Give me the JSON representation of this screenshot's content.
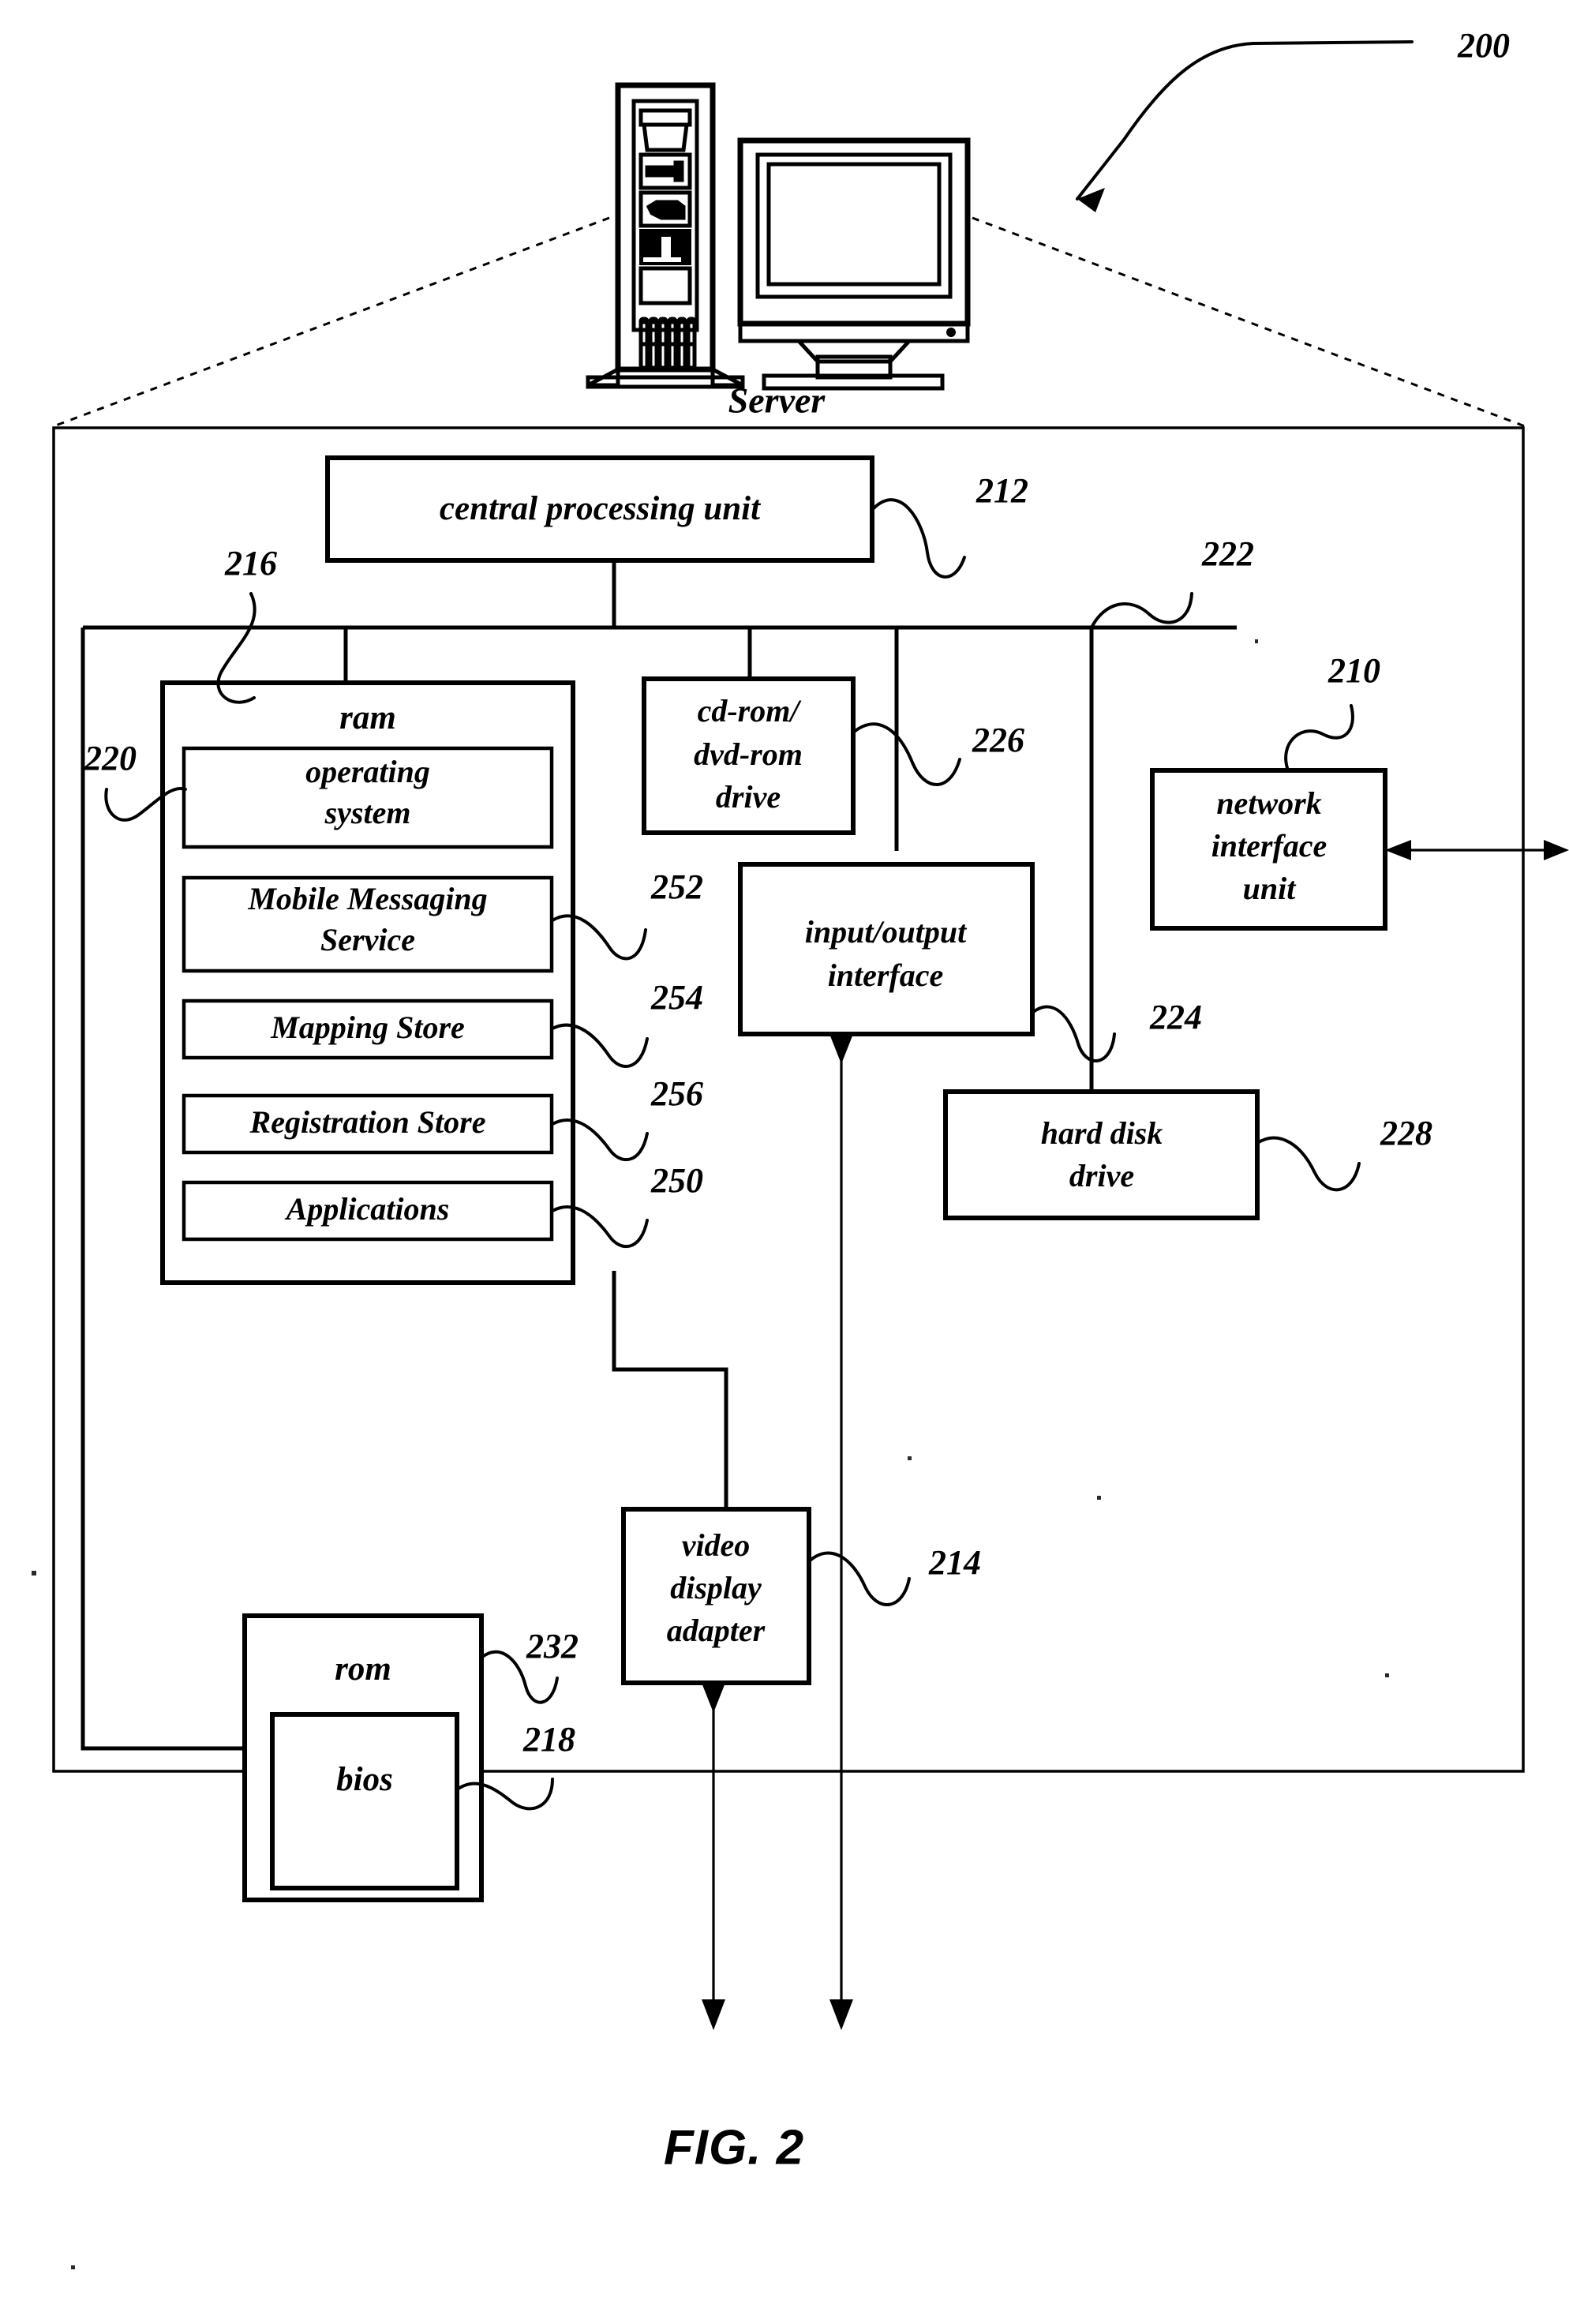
{
  "figure": {
    "caption": "FIG. 2",
    "system_ref": "200",
    "server_label": "Server"
  },
  "outer_enclosure": {
    "name": "server-internals-enclosure"
  },
  "blocks": [
    {
      "id": "cpu",
      "label": "central processing unit",
      "ref": "212"
    },
    {
      "id": "ram",
      "label": "ram",
      "ref": "216"
    },
    {
      "id": "operating-system",
      "label": "operating system",
      "ref": "220"
    },
    {
      "id": "mobile-messaging-service",
      "label": "Mobile Messaging Service",
      "ref": "252"
    },
    {
      "id": "mapping-store",
      "label": "Mapping Store",
      "ref": "254"
    },
    {
      "id": "registration-store",
      "label": "Registration Store",
      "ref": "256"
    },
    {
      "id": "applications",
      "label": "Applications",
      "ref": "250"
    },
    {
      "id": "cdrom-drive",
      "label": "cd-rom/ dvd-rom drive",
      "ref": "226"
    },
    {
      "id": "io-interface",
      "label": "input/output interface",
      "ref": "222"
    },
    {
      "id": "network-interface-unit",
      "label": "network interface unit",
      "ref": "210"
    },
    {
      "id": "hard-disk-drive",
      "label": "hard disk drive",
      "ref": "228"
    },
    {
      "id": "video-display-adapter",
      "label": "video display adapter",
      "ref": "214"
    },
    {
      "id": "rom",
      "label": "rom",
      "ref": "232"
    },
    {
      "id": "bios",
      "label": "bios",
      "ref": "218"
    }
  ],
  "labels": {
    "cpu": "central processing unit",
    "ram": "ram",
    "operating_system_line1": "operating",
    "operating_system_line2": "system",
    "mobile_messaging_line1": "Mobile Messaging",
    "mobile_messaging_line2": "Service",
    "mapping_store": "Mapping Store",
    "registration_store": "Registration Store",
    "applications": "Applications",
    "cdrom_line1": "cd-rom/",
    "cdrom_line2": "dvd-rom",
    "cdrom_line3": "drive",
    "io_line1": "input/output",
    "io_line2": "interface",
    "niu_line1": "network",
    "niu_line2": "interface",
    "niu_line3": "unit",
    "hdd_line1": "hard disk",
    "hdd_line2": "drive",
    "vda_line1": "video",
    "vda_line2": "display",
    "vda_line3": "adapter",
    "rom": "rom",
    "bios": "bios"
  },
  "reference_numerals": {
    "system": "200",
    "network_interface_unit": "210",
    "cpu": "212",
    "video_display_adapter": "214",
    "ram": "216",
    "bios": "218",
    "operating_system": "220",
    "io_interface": "222",
    "hard_disk_bus": "224",
    "cdrom_drive": "226",
    "hard_disk_drive": "228",
    "rom": "232",
    "applications": "250",
    "mobile_messaging_service": "252",
    "mapping_store": "254",
    "registration_store": "256"
  },
  "colors": {
    "ink": "#000000",
    "paper": "#ffffff"
  }
}
